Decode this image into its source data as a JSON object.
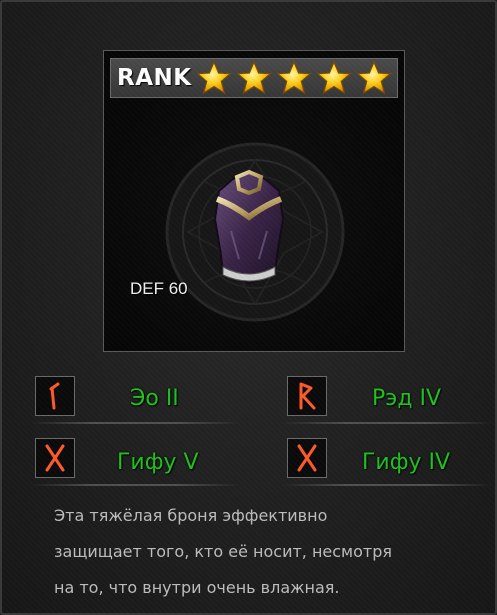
{
  "item": {
    "rank_label": "RANK",
    "stars_filled": 5,
    "stars_total": 5,
    "icon": "chest-armor-icon",
    "stat_text": "DEF 60"
  },
  "runes": [
    {
      "icon": "eo-rune-icon",
      "name": "Эо II"
    },
    {
      "icon": "red-rune-icon",
      "name": "Рэд IV"
    },
    {
      "icon": "gifu-rune-icon",
      "name": "Гифу V"
    },
    {
      "icon": "gifu-rune-icon",
      "name": "Гифу IV"
    }
  ],
  "description": {
    "line1": "Эта тяжёлая броня эффективно",
    "line2": "защищает того, кто её носит, несмотря",
    "line3": "на то, что внутри очень влажная."
  },
  "colors": {
    "rune_name": "#1ec21e",
    "rune_glyph": "#ff5a2a",
    "star": "#f7c21a"
  }
}
